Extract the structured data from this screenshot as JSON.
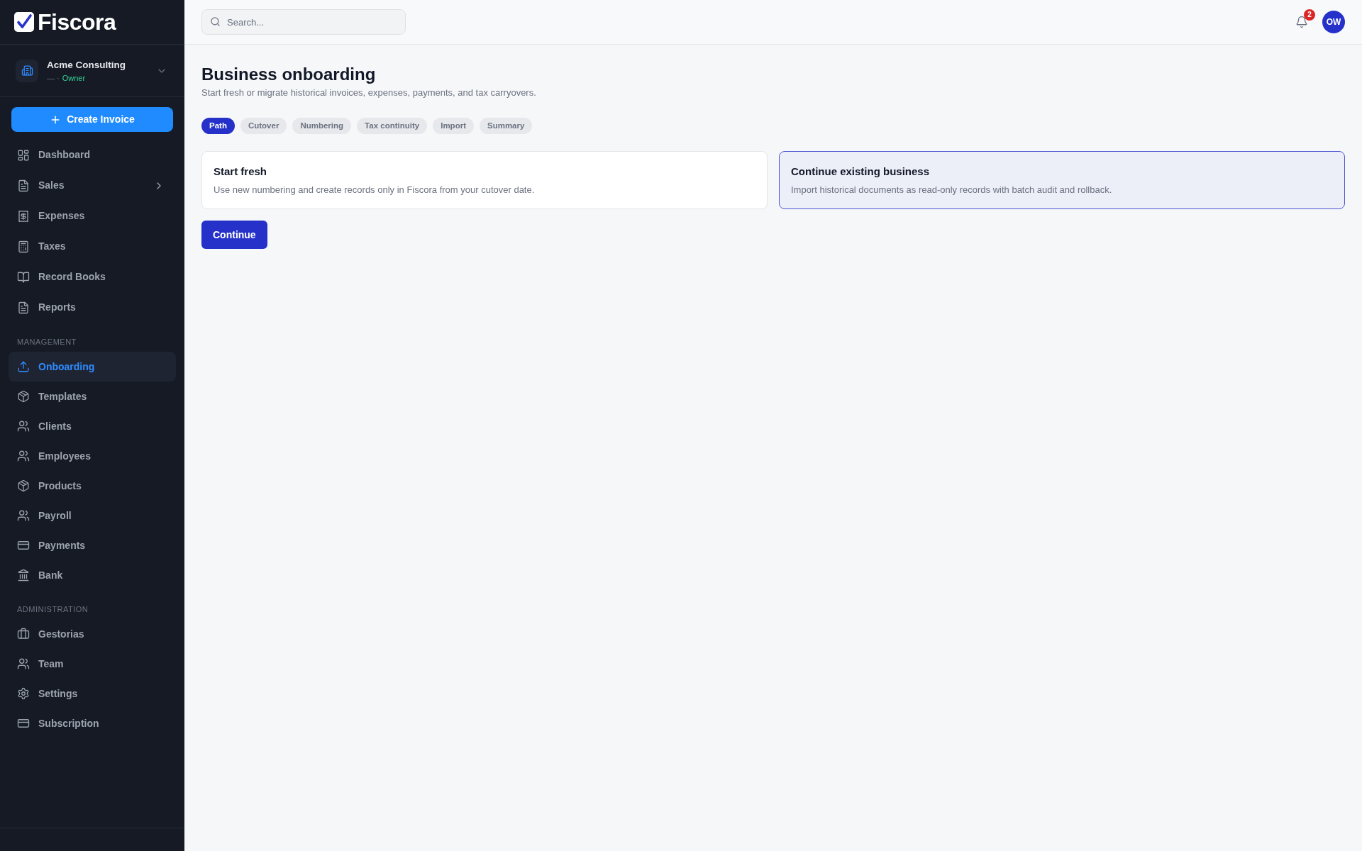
{
  "sidebar": {
    "brand": "Fiscora",
    "account": {
      "name": "Acme Consulting",
      "detail": "— ·",
      "role": "Owner"
    },
    "create_button": "Create Invoice",
    "sections": [
      {
        "items": [
          {
            "label": "Dashboard",
            "kind": "link",
            "selected": false
          },
          {
            "label": "Sales",
            "kind": "group",
            "expanded": false,
            "selected": false
          },
          {
            "label": "Expenses",
            "kind": "link",
            "selected": false
          },
          {
            "label": "Taxes",
            "kind": "link",
            "selected": false
          },
          {
            "label": "Record Books",
            "kind": "link",
            "selected": false
          },
          {
            "label": "Reports",
            "kind": "link",
            "selected": false
          }
        ]
      },
      {
        "heading": "MANAGEMENT",
        "items": [
          {
            "label": "Onboarding",
            "kind": "link",
            "selected": true
          },
          {
            "label": "Templates",
            "kind": "link",
            "selected": false
          },
          {
            "label": "Clients",
            "kind": "link",
            "selected": false
          },
          {
            "label": "Employees",
            "kind": "link",
            "selected": false
          },
          {
            "label": "Products",
            "kind": "link",
            "selected": false
          },
          {
            "label": "Payroll",
            "kind": "link",
            "selected": false
          },
          {
            "label": "Payments",
            "kind": "link",
            "selected": false
          },
          {
            "label": "Bank",
            "kind": "link",
            "selected": false
          }
        ]
      },
      {
        "heading": "ADMINISTRATION",
        "items": [
          {
            "label": "Gestorias",
            "kind": "link",
            "selected": false
          },
          {
            "label": "Team",
            "kind": "link",
            "selected": false
          },
          {
            "label": "Settings",
            "kind": "link",
            "selected": false
          },
          {
            "label": "Subscription",
            "kind": "link",
            "selected": false
          }
        ]
      }
    ]
  },
  "topbar": {
    "search": {
      "placeholder": "Search..."
    },
    "notifications": {
      "count": "2"
    },
    "avatar": {
      "initials": "OW"
    }
  },
  "page": {
    "title": "Business onboarding",
    "subtitle": "Start fresh or migrate historical invoices, expenses, payments, and tax carryovers.",
    "steps": [
      {
        "label": "Path",
        "selected": true
      },
      {
        "label": "Cutover",
        "selected": false
      },
      {
        "label": "Numbering",
        "selected": false
      },
      {
        "label": "Tax continuity",
        "selected": false
      },
      {
        "label": "Import",
        "selected": false
      },
      {
        "label": "Summary",
        "selected": false
      }
    ],
    "options": [
      {
        "title": "Start fresh",
        "description": "Use new numbering and create records only in Fiscora from your cutover date.",
        "selected": false
      },
      {
        "title": "Continue existing business",
        "description": "Import historical documents as read-only records with batch audit and rollback.",
        "selected": true
      }
    ],
    "continue_button": "Continue"
  }
}
